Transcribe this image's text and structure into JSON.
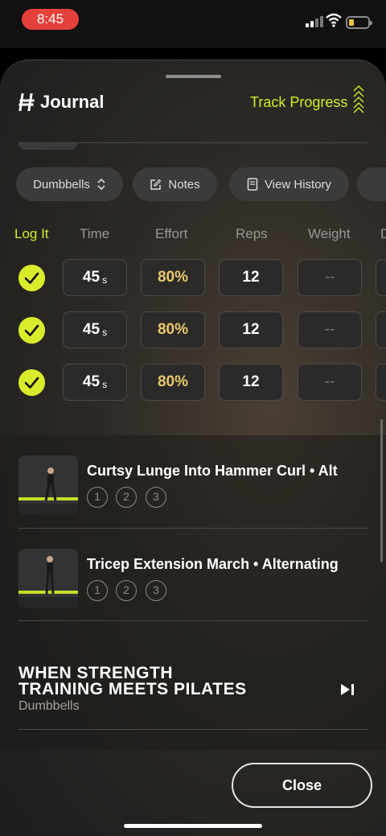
{
  "status_bar": {
    "time": "8:45"
  },
  "header": {
    "title": "Journal",
    "track_label": "Track Progress"
  },
  "filters": {
    "equipment": "Dumbbells",
    "notes": "Notes",
    "history": "View History"
  },
  "columns": [
    "Log It",
    "Time",
    "Effort",
    "Reps",
    "Weight",
    "D"
  ],
  "sets": [
    {
      "time": "45",
      "time_unit": "s",
      "effort": "80%",
      "reps": "12",
      "weight": "--"
    },
    {
      "time": "45",
      "time_unit": "s",
      "effort": "80%",
      "reps": "12",
      "weight": "--"
    },
    {
      "time": "45",
      "time_unit": "s",
      "effort": "80%",
      "reps": "12",
      "weight": "--"
    }
  ],
  "exercises": [
    {
      "name": "Curtsy Lunge Into Hammer Curl • Alt",
      "sets": [
        "1",
        "2",
        "3"
      ]
    },
    {
      "name": "Tricep Extension March • Alternating",
      "sets": [
        "1",
        "2",
        "3"
      ]
    }
  ],
  "workout": {
    "title_line1": "WHEN STRENGTH",
    "title_line2": "TRAINING MEETS PILATES",
    "equipment": "Dumbbells"
  },
  "footer": {
    "close_label": "Close"
  },
  "colors": {
    "accent": "#d8ec2c",
    "effort": "#e9c96c",
    "status_pill": "#e5413c"
  }
}
